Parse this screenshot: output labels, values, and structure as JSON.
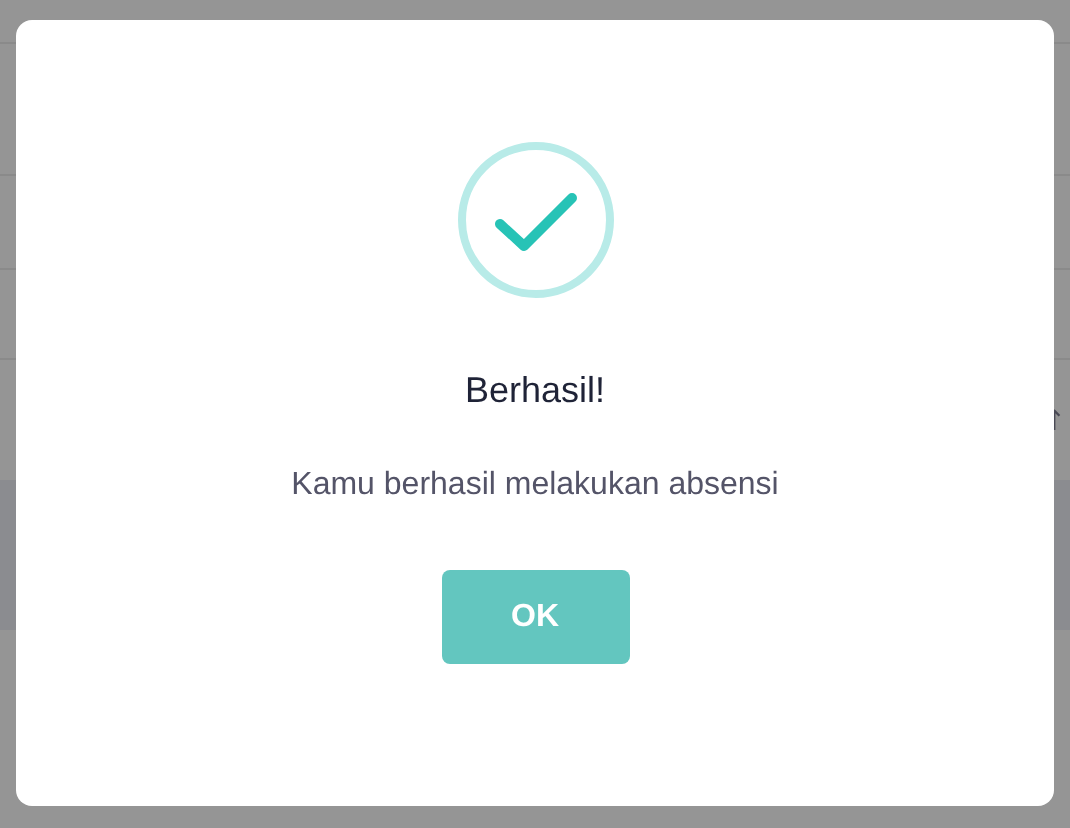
{
  "background": {
    "sort_icon": "↑"
  },
  "dialog": {
    "kind": "success",
    "title": "Berhasil!",
    "message": "Kamu berhasil melakukan absensi",
    "buttons": [
      {
        "label": "OK"
      }
    ]
  }
}
